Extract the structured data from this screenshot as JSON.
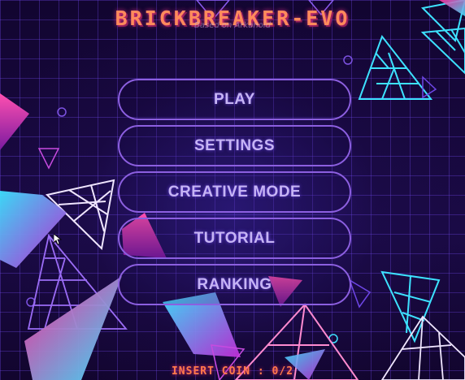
{
  "game": {
    "title": "BRICKBREAKER-EVO",
    "subtitle": "Based on Arkanoid"
  },
  "menu": {
    "items": [
      {
        "label": "PLAY"
      },
      {
        "label": "SETTINGS"
      },
      {
        "label": "CREATIVE MODE"
      },
      {
        "label": "TUTORIAL"
      },
      {
        "label": "RANKING"
      }
    ]
  },
  "footer": {
    "insert_coin": "INSERT COIN : 0/2"
  },
  "colors": {
    "background": "#12062e",
    "grid": "#6e46e6",
    "neon_cyan": "#3de2ff",
    "neon_pink": "#ff2f9e",
    "button_border": "#8c5fe0",
    "title": "#ff8a5c"
  },
  "icons": [
    "mouse-cursor-icon"
  ]
}
